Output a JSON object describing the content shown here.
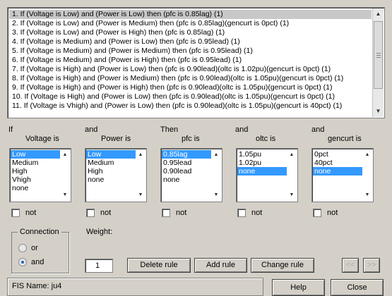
{
  "rules": [
    "1. If (Voltage is Low) and (Power is Low) then (pfc is 0.85lag) (1)",
    "2. If (Voltage is Low) and (Power is Medium) then (pfc is 0.85lag)(gencurt is 0pct) (1)",
    "3. If (Voltage is Low) and (Power is High) then (pfc is 0.85lag) (1)",
    "4. If (Voltage is Medium) and (Power is Low) then (pfc is 0.95lead) (1)",
    "5. If (Voltage is Medium) and (Power is Medium) then (pfc is 0.95lead) (1)",
    "6. If (Voltage is Medium) and (Power is High) then (pfc is 0.95lead) (1)",
    "7. If (Voltage is High) and (Power is Low) then (pfc is 0.90lead)(oltc is 1.02pu)(gencurt is 0pct) (1)",
    "8. If (Voltage is High) and (Power is Medium) then (pfc is 0.90lead)(oltc is 1.05pu)(gencurt is 0pct) (1)",
    "9. If (Voltage is High) and (Power is High) then (pfc is 0.90lead)(oltc is 1.05pu)(gencurt is 0pct) (1)",
    "10. If (Voltage is High) and (Power is Low) then (pfc is 0.90lead)(oltc is 1.05pu)(gencurt is 0pct) (1)",
    "11. If (Voltage is Vhigh) and (Power is Low) then (pfc is 0.90lead)(oltc is 1.05pu)(gencurt is 40pct) (1)"
  ],
  "selected_rule": 0,
  "columns": [
    {
      "prefix": "If",
      "name": "Voltage is",
      "items": [
        "Low",
        "Medium",
        "High",
        "Vhigh",
        "none"
      ],
      "selected": 0
    },
    {
      "prefix": "and",
      "name": "Power is",
      "items": [
        "Low",
        "Medium",
        "High",
        "none"
      ],
      "selected": 0
    },
    {
      "prefix": "Then",
      "name": "pfc is",
      "items": [
        "0.85lag",
        "0.95lead",
        "0.90lead",
        "none"
      ],
      "selected": 0
    },
    {
      "prefix": "and",
      "name": "oltc is",
      "items": [
        "1.05pu",
        "1.02pu",
        "none"
      ],
      "selected": 2
    },
    {
      "prefix": "and",
      "name": "gencurt is",
      "items": [
        "0pct",
        "40pct",
        "none"
      ],
      "selected": 2
    }
  ],
  "not_label": "not",
  "connection": {
    "title": "Connection",
    "options": [
      "or",
      "and"
    ],
    "selected": "and"
  },
  "weight": {
    "label": "Weight:",
    "value": "1"
  },
  "buttons": {
    "delete_rule": "Delete rule",
    "add_rule": "Add rule",
    "change_rule": "Change rule",
    "prev": "<<",
    "next": ">>",
    "help": "Help",
    "close": "Close"
  },
  "status": "FIS Name: ju4"
}
